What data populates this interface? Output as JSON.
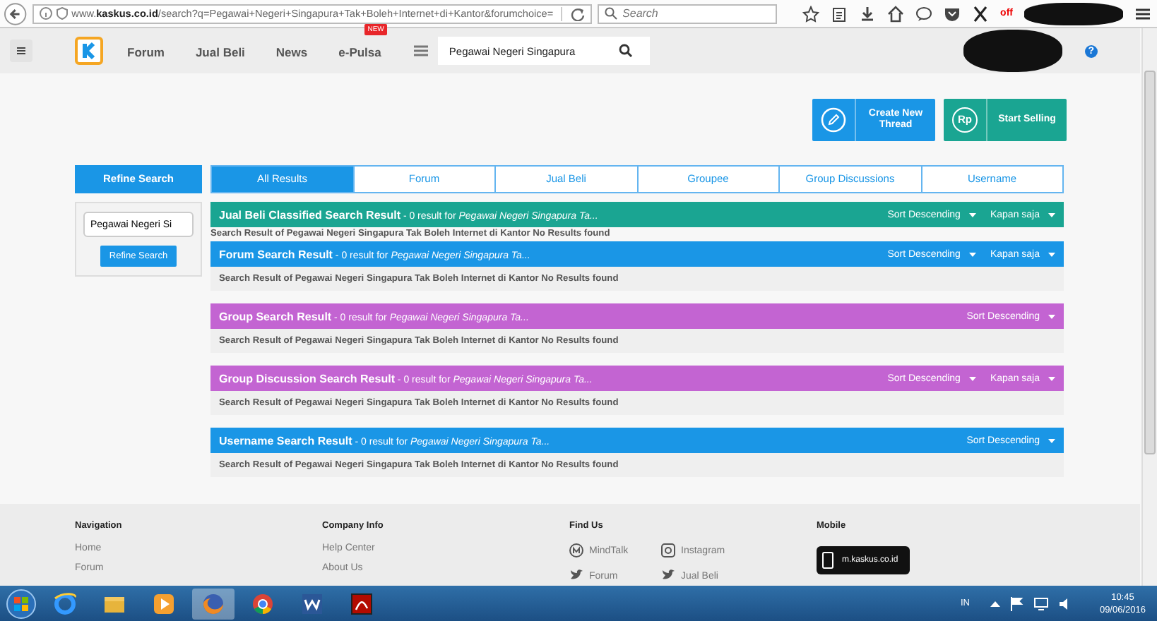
{
  "browser": {
    "url": "www.**kaskus.co.id**/search?q=Pegawai+Negeri+Singapura+Tak+Boleh+Internet+di+Kantor&forumchoice=",
    "search_placeholder": "Search",
    "addon_label": "off"
  },
  "site_header": {
    "nav": [
      {
        "label": "Forum"
      },
      {
        "label": "Jual Beli"
      },
      {
        "label": "News"
      },
      {
        "label": "e-Pulsa",
        "badge": "NEW"
      }
    ],
    "search_value": "Pegawai Negeri Singapura",
    "help": "?"
  },
  "actions": [
    {
      "label": "Create New Thread",
      "color": "#1a96e6"
    },
    {
      "label": "Start Selling",
      "icon_text": "Rp",
      "color": "#1aa592"
    }
  ],
  "refine": {
    "title": "Refine Search",
    "value": "Pegawai Negeri Si",
    "button": "Refine Search"
  },
  "tabs": [
    {
      "label": "All Results",
      "selected": true
    },
    {
      "label": "Forum",
      "selected": false
    },
    {
      "label": "Jual Beli",
      "selected": false
    },
    {
      "label": "Groupee",
      "selected": false
    },
    {
      "label": "Group Discussions",
      "selected": false
    },
    {
      "label": "Username",
      "selected": false
    }
  ],
  "sections": [
    {
      "title": "Jual Beli Classified Search Result",
      "summary": "- 0 result for",
      "query": "Pegawai Negeri Singapura Ta...",
      "color": "#1aa592",
      "sort": "Sort Descending",
      "time_filter": "Kapan saja",
      "kind": "plain",
      "message": "Search Result of Pegawai Negeri Singapura Tak Boleh Internet di Kantor No Results found"
    },
    {
      "title": "Forum Search Result",
      "summary": "- 0 result for",
      "query": "Pegawai Negeri Singapura Ta...",
      "color": "#1a96e6",
      "sort": "Sort Descending",
      "time_filter": "Kapan saja",
      "kind": "boxed",
      "message": "Search Result of Pegawai Negeri Singapura Tak Boleh Internet di Kantor No Results found"
    },
    {
      "title": "Group Search Result",
      "summary": "- 0 result for",
      "query": "Pegawai Negeri Singapura Ta...",
      "color": "#c364d2",
      "sort": "Sort Descending",
      "kind": "boxed",
      "message": "Search Result of Pegawai Negeri Singapura Tak Boleh Internet di Kantor No Results found"
    },
    {
      "title": "Group Discussion Search Result",
      "summary": "- 0 result for",
      "query": "Pegawai Negeri Singapura Ta...",
      "color": "#c364d2",
      "sort": "Sort Descending",
      "time_filter": "Kapan saja",
      "kind": "boxed",
      "message": "Search Result of Pegawai Negeri Singapura Tak Boleh Internet di Kantor No Results found"
    },
    {
      "title": "Username Search Result",
      "summary": "- 0 result for",
      "query": "Pegawai Negeri Singapura Ta...",
      "color": "#1a96e6",
      "sort": "Sort Descending",
      "kind": "boxed",
      "message": "Search Result of Pegawai Negeri Singapura Tak Boleh Internet di Kantor No Results found"
    }
  ],
  "footer": {
    "columns": [
      {
        "title": "Navigation",
        "links": [
          "Home",
          "Forum"
        ]
      },
      {
        "title": "Company Info",
        "links": [
          "Help Center",
          "About Us"
        ]
      },
      {
        "title": "Find Us",
        "social": [
          {
            "label": "MindTalk"
          },
          {
            "label": "Instagram"
          },
          {
            "label": "Forum"
          },
          {
            "label": "Jual Beli"
          }
        ]
      },
      {
        "title": "Mobile",
        "app_label": "m.kaskus.co.id"
      }
    ]
  },
  "taskbar": {
    "apps": [
      {
        "selected": false
      },
      {
        "selected": false
      },
      {
        "selected": false
      },
      {
        "selected": true
      },
      {
        "selected": false
      },
      {
        "selected": false
      },
      {
        "selected": false
      }
    ],
    "language": "IN",
    "time": "10:45",
    "date": "09/06/2016"
  }
}
